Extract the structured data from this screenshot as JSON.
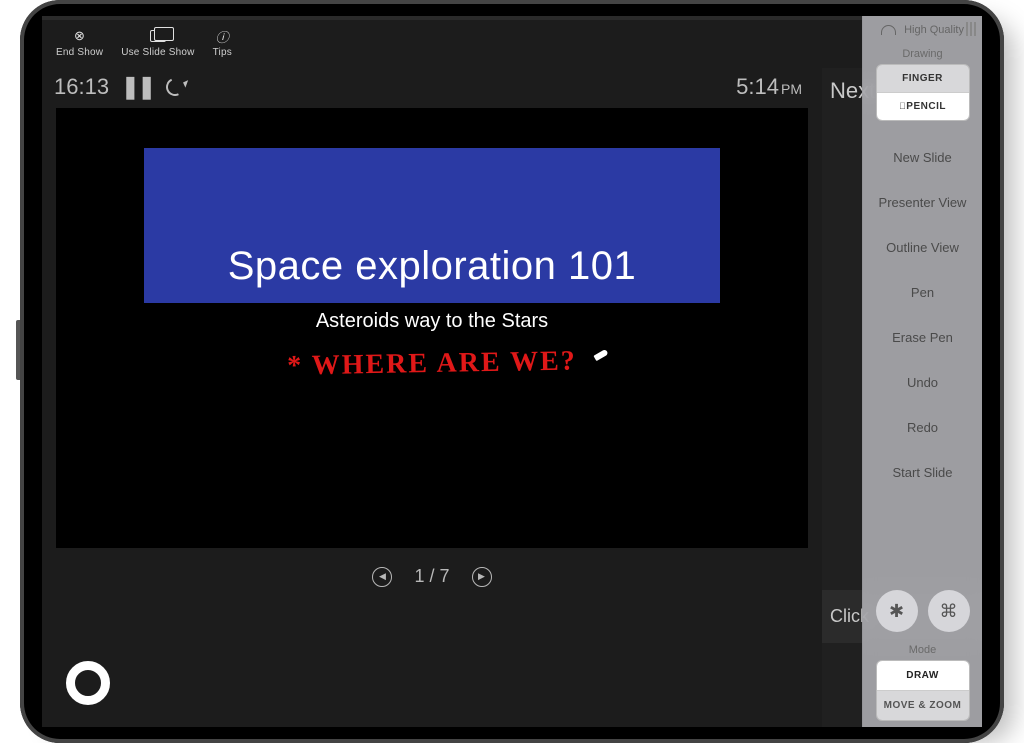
{
  "toolbar": {
    "end_show": "End Show",
    "use_slide_show": "Use Slide Show",
    "tips": "Tips"
  },
  "timer": {
    "elapsed": "16:13",
    "clock": "5:14",
    "ampm": "PM"
  },
  "slide": {
    "title": "Space exploration 101",
    "subtitle": "Asteroids way to the Stars",
    "annotation": "* WHERE  ARE  WE?",
    "counter": "1 / 7"
  },
  "panel": {
    "next": "Next",
    "click": "Click"
  },
  "sidebar": {
    "connection": "High Quality",
    "drawing_label": "Drawing",
    "finger": "FINGER",
    "pencil": "PENCIL",
    "menu": [
      "New Slide",
      "Presenter View",
      "Outline View",
      "Pen",
      "Erase Pen",
      "Undo",
      "Redo",
      "Start Slide"
    ],
    "mode_label": "Mode",
    "mode_draw": "DRAW",
    "mode_move": "MOVE & ZOOM"
  }
}
